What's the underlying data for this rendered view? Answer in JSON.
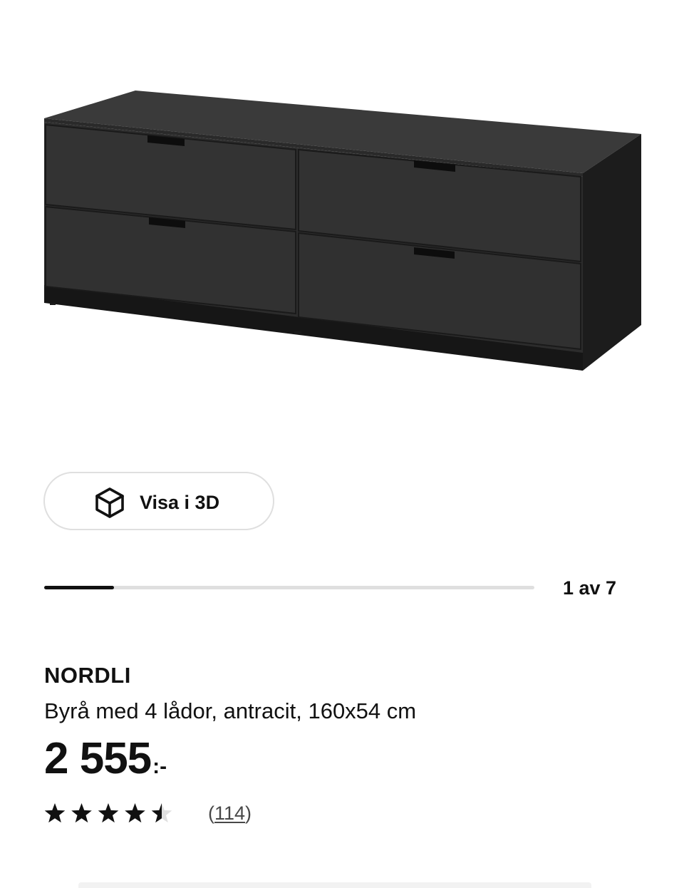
{
  "product": {
    "image_alt": "NORDLI Byrå med 4 lådor, antracit, 160x54 cm",
    "name": "NORDLI",
    "description": "Byrå med 4 lådor, antracit, 160x54 cm",
    "price": {
      "amount": "2 555",
      "suffix": ":-"
    },
    "rating": {
      "stars": 4.5,
      "max_stars": 5,
      "review_count_open": "(",
      "review_count": "114",
      "review_count_close": ")"
    }
  },
  "view_3d": {
    "label": "Visa i 3D",
    "icon": "cube-3d-icon"
  },
  "carousel": {
    "counter": "1 av 7",
    "current": 1,
    "total": 7
  },
  "colors": {
    "text": "#111111",
    "track": "#dfdfdf",
    "furniture": "#2b2b2b"
  }
}
